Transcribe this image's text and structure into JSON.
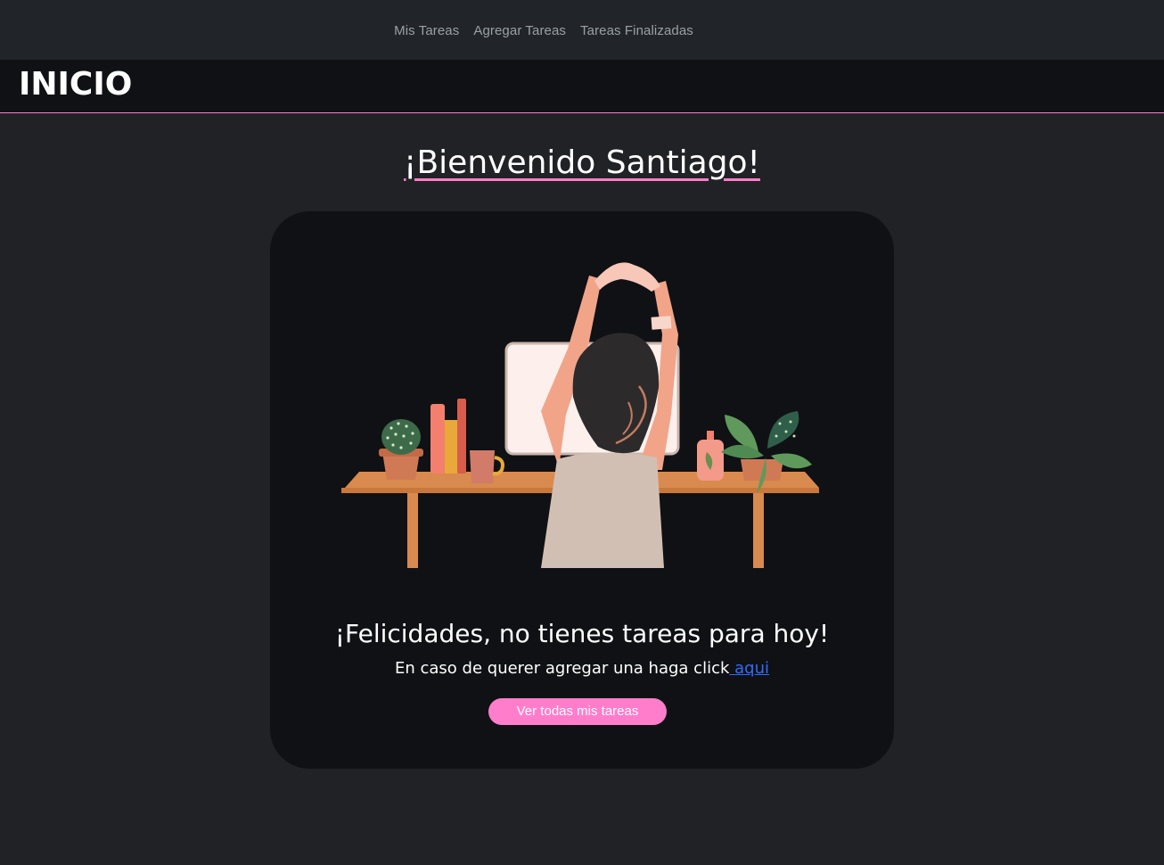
{
  "nav": {
    "items": [
      {
        "label": "Mis Tareas"
      },
      {
        "label": "Agregar Tareas"
      },
      {
        "label": "Tareas Finalizadas"
      }
    ]
  },
  "header": {
    "title": "INICIO"
  },
  "main": {
    "welcome": "¡Bienvenido Santiago!",
    "card": {
      "message": "¡Felicidades, no tienes tareas para hoy!",
      "hint_prefix": "En caso de querer agregar una haga click",
      "hint_link": "aqui",
      "button_label": "Ver todas mis tareas"
    }
  },
  "colors": {
    "accent": "#ff7dcb",
    "nav_bg": "#212529",
    "header_bg": "#101114",
    "page_bg": "#212225",
    "card_bg": "#101114",
    "link": "#2f6bff"
  },
  "illustration": {
    "name": "woman-stretching-at-desk-illustration"
  }
}
